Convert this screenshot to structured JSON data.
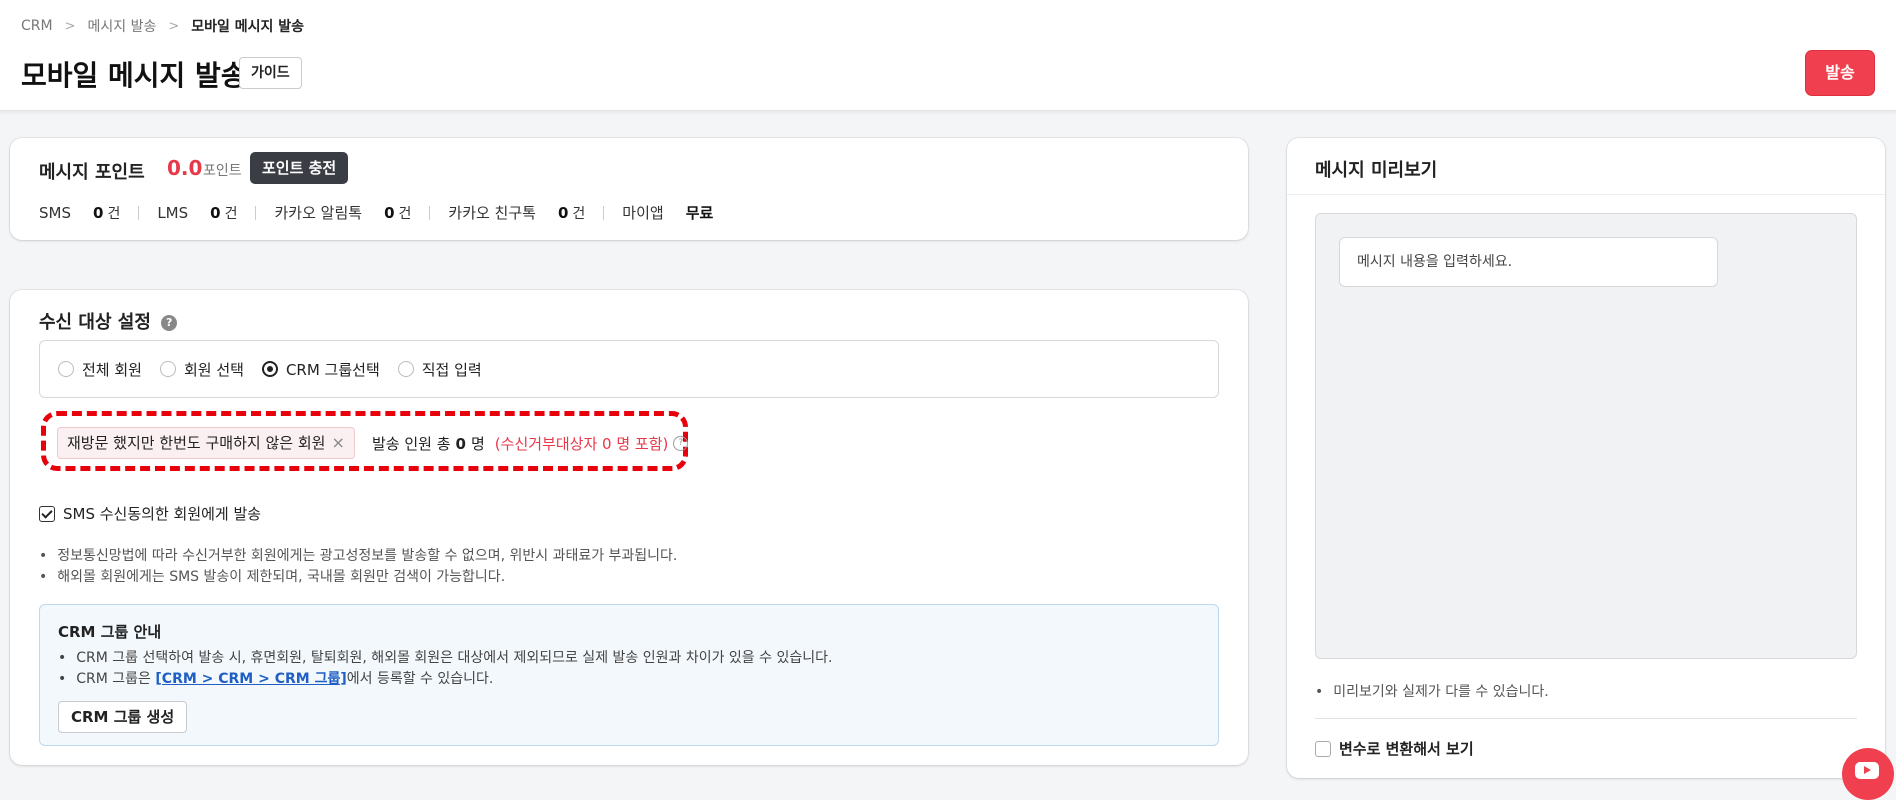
{
  "breadcrumb": [
    "CRM",
    "메시지 발송",
    "모바일 메시지 발송"
  ],
  "page_title": "모바일 메시지 발송",
  "guide_label": "가이드",
  "send_label": "발송",
  "points": {
    "title": "메시지 포인트",
    "value": "0.0",
    "unit": "포인트",
    "charge_label": "포인트 충전",
    "counts": [
      {
        "label": "SMS",
        "value": "0",
        "unit": "건"
      },
      {
        "label": "LMS",
        "value": "0",
        "unit": "건"
      },
      {
        "label": "카카오 알림톡",
        "value": "0",
        "unit": "건"
      },
      {
        "label": "카카오 친구톡",
        "value": "0",
        "unit": "건"
      },
      {
        "label": "마이앱",
        "value": "무료",
        "unit": ""
      }
    ]
  },
  "target": {
    "title": "수신 대상 설정",
    "options": [
      "전체 회원",
      "회원 선택",
      "CRM 그룹선택",
      "직접 입력"
    ],
    "selected_option": "CRM 그룹선택",
    "chip_label": "재방문 했지만 한번도 구매하지 않은 회원",
    "send_count_prefix": "발송 인원 총",
    "send_count_value": "0",
    "send_count_unit": "명",
    "reject_text": "(수신거부대상자 0 명 포함)",
    "consent_label": "SMS 수신동의한 회원에게 발송",
    "consent_checked": true,
    "notes": [
      "정보통신망법에 따라 수신거부한 회원에게는 광고성정보를 발송할 수 없으며, 위반시 과태료가 부과됩니다.",
      "해외몰 회원에게는 SMS 발송이 제한되며, 국내몰 회원만 검색이 가능합니다."
    ],
    "info": {
      "title": "CRM 그룹 안내",
      "line1": "CRM 그룹 선택하여 발송 시, 휴면회원, 탈퇴회원, 해외몰 회원은 대상에서 제외되므로 실제 발송 인원과 차이가 있을 수 있습니다.",
      "line2_prefix": "CRM 그룹은 ",
      "line2_link": "[CRM > CRM > CRM 그룹]",
      "line2_suffix": "에서 등록할 수 있습니다.",
      "create_button": "CRM 그룹 생성"
    }
  },
  "preview": {
    "title": "메시지 미리보기",
    "placeholder": "메시지 내용을 입력하세요.",
    "note": "미리보기와 실제가 다를 수 있습니다.",
    "variable_label": "변수로 변환해서 보기",
    "variable_checked": false
  },
  "colors": {
    "accent": "#f0404f",
    "points_value": "#e8394a",
    "link": "#1f5ec2",
    "highlight": "#e8000b"
  }
}
